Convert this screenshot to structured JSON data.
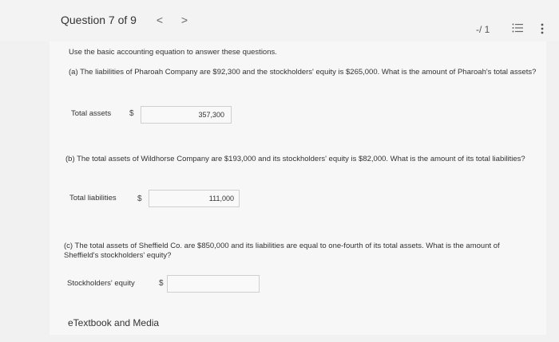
{
  "header": {
    "question_title": "Question 7 of 9",
    "prev_icon": "<",
    "next_icon": ">",
    "score": "-/ 1",
    "list_icon_name": "list-icon",
    "more_icon_name": "more-vertical-icon"
  },
  "question": {
    "intro": "Use the basic accounting equation to answer these questions.",
    "part_a": {
      "text": "(a) The liabilities of Pharoah Company are $92,300 and the stockholders' equity is $265,000. What is the amount of Pharoah's total assets?",
      "label": "Total assets",
      "currency": "$",
      "value": "357,300"
    },
    "part_b": {
      "text": "(b) The total assets of Wildhorse Company are $193,000 and its stockholders' equity is $82,000. What is the amount of its total liabilities?",
      "label": "Total liabilities",
      "currency": "$",
      "value": "111,000"
    },
    "part_c": {
      "text": "(c) The total assets of Sheffield Co. are $850,000 and its liabilities are equal to one-fourth of its total assets. What is the amount of Sheffield's stockholders' equity?",
      "label": "Stockholders' equity",
      "currency": "$",
      "value": ""
    }
  },
  "footer": {
    "etextbook_label": "eTextbook and Media"
  }
}
